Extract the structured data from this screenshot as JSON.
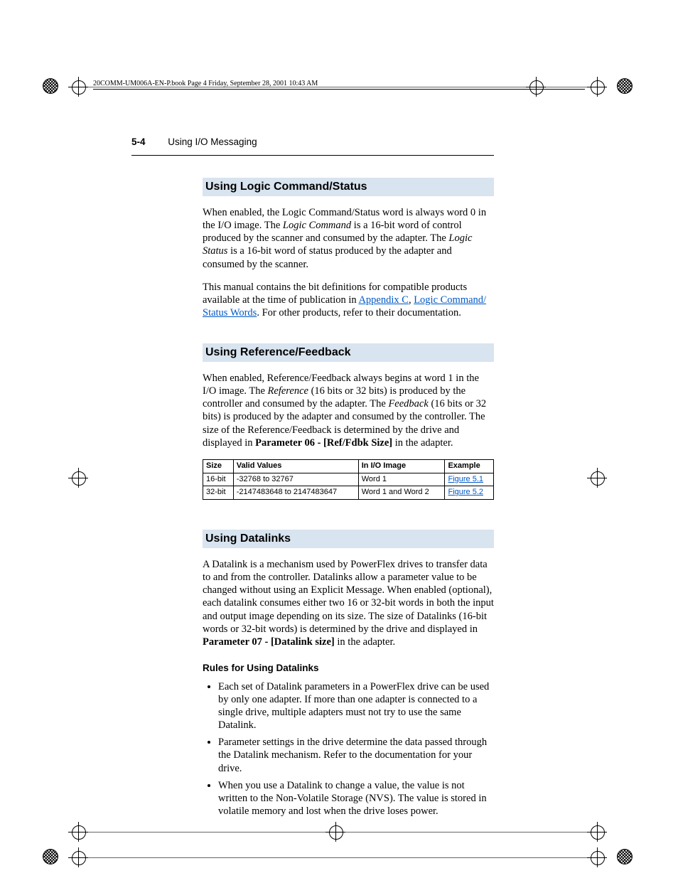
{
  "bookline": "20COMM-UM006A-EN-P.book  Page 4  Friday, September 28, 2001  10:43 AM",
  "header": {
    "page_number": "5-4",
    "running_title": "Using I/O Messaging"
  },
  "sections": {
    "logic": {
      "heading": "Using Logic Command/Status",
      "p1_a": "When enabled, the Logic Command/Status word is always word 0 in the I/O image. The ",
      "p1_em1": "Logic Command",
      "p1_b": " is a 16-bit word of control produced by the scanner and consumed by the adapter. The ",
      "p1_em2": "Logic Status",
      "p1_c": " is a 16-bit word of status produced by the adapter and consumed by the scanner.",
      "p2_a": "This manual contains the bit definitions for compatible products available at the time of publication in ",
      "p2_link1": "Appendix C",
      "p2_b": ", ",
      "p2_link2": "Logic Command/ Status Words",
      "p2_c": ". For other products, refer to their documentation."
    },
    "ref": {
      "heading": "Using Reference/Feedback",
      "p1_a": "When enabled, Reference/Feedback always begins at word 1 in the I/O image. The ",
      "p1_em1": "Reference",
      "p1_b": " (16 bits or 32 bits) is produced by the controller and consumed by the adapter. The ",
      "p1_em2": "Feedback",
      "p1_c": " (16 bits or 32 bits) is produced by the adapter and consumed by the controller. The size of the Reference/Feedback is determined by the drive and displayed in ",
      "p1_bold": "Parameter 06 - [Ref/Fdbk Size]",
      "p1_d": " in the adapter.",
      "table": {
        "headers": [
          "Size",
          "Valid Values",
          "In I/O Image",
          "Example"
        ],
        "rows": [
          [
            "16-bit",
            "-32768 to 32767",
            "Word 1",
            "Figure 5.1"
          ],
          [
            "32-bit",
            "-2147483648 to 2147483647",
            "Word 1 and Word 2",
            "Figure 5.2"
          ]
        ]
      }
    },
    "dlink": {
      "heading": "Using Datalinks",
      "p1_a": "A Datalink is a mechanism used by PowerFlex drives to transfer data to and from the controller. Datalinks allow a parameter value to be changed without using an Explicit Message. When enabled (optional), each datalink consumes either two 16 or 32-bit words in both the input and output image depending on its size. The size of Datalinks (16-bit words or 32-bit words) is determined by the drive and displayed in ",
      "p1_bold": "Parameter 07 - [Datalink size]",
      "p1_b": " in the adapter.",
      "subhead": "Rules for Using Datalinks",
      "bullets": [
        "Each set of Datalink parameters in a PowerFlex drive can be used by only one adapter. If more than one adapter is connected to a single drive, multiple adapters must not try to use the same Datalink.",
        "Parameter settings in the drive determine the data passed through the Datalink mechanism. Refer to the documentation for your drive.",
        "When you use a Datalink to change a value, the value is not written to the Non-Volatile Storage (NVS). The value is stored in volatile memory and lost when the drive loses power."
      ]
    }
  }
}
